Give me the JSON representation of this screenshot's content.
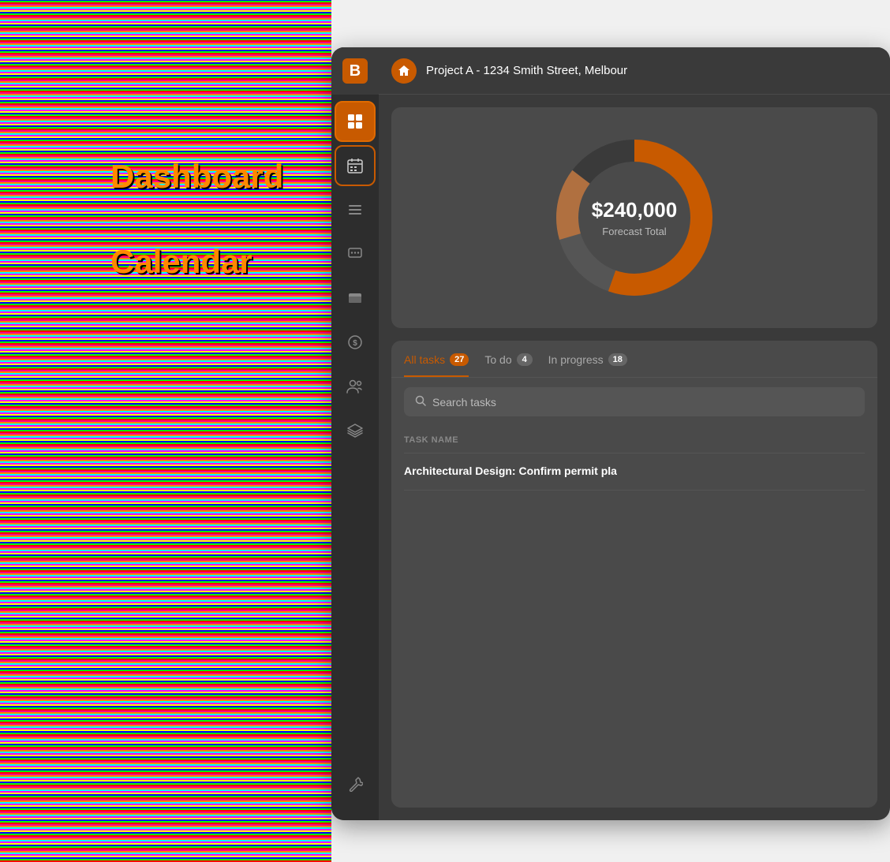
{
  "app": {
    "title": "Project A - 1234 Smith Street, Melbour"
  },
  "sidebar": {
    "logo_text": "B",
    "nav_items": [
      {
        "id": "dashboard",
        "icon": "⊞",
        "label": "Dashboard",
        "active": true
      },
      {
        "id": "calendar",
        "icon": "📅",
        "label": "Calendar",
        "second_active": true
      },
      {
        "id": "tasks-list",
        "icon": "≡",
        "label": "Tasks List",
        "active": false
      },
      {
        "id": "messages",
        "icon": "💬",
        "label": "Messages",
        "active": false
      },
      {
        "id": "files",
        "icon": "▬",
        "label": "Files",
        "active": false
      },
      {
        "id": "budget",
        "icon": "$",
        "label": "Budget",
        "active": false
      },
      {
        "id": "team",
        "icon": "👥",
        "label": "Team",
        "active": false
      },
      {
        "id": "layers",
        "icon": "◈",
        "label": "Layers",
        "active": false
      },
      {
        "id": "tools",
        "icon": "🔧",
        "label": "Tools",
        "active": false
      }
    ]
  },
  "header": {
    "home_icon": "🏠",
    "project_title": "Project A - 1234 Smith Street, Melbour"
  },
  "chart": {
    "amount": "$240,000",
    "label": "Forecast Total",
    "segments": [
      {
        "color": "#c85a00",
        "value": 55
      },
      {
        "color": "#666666",
        "value": 15
      },
      {
        "color": "#c8a080",
        "value": 15
      },
      {
        "color": "#3a3a3a",
        "value": 15
      }
    ]
  },
  "tasks": {
    "tabs": [
      {
        "id": "all",
        "label": "All tasks",
        "count": "27",
        "active": true
      },
      {
        "id": "todo",
        "label": "To do",
        "count": "4",
        "active": false
      },
      {
        "id": "inprogress",
        "label": "In progress",
        "count": "18",
        "active": false
      }
    ],
    "search_placeholder": "Search tasks",
    "column_header": "TASK NAME",
    "rows": [
      {
        "name": "Architectural Design: Confirm permit pla"
      }
    ]
  },
  "overlay": {
    "dashboard_label": "Dashboard",
    "calendar_label": "Calendar"
  }
}
